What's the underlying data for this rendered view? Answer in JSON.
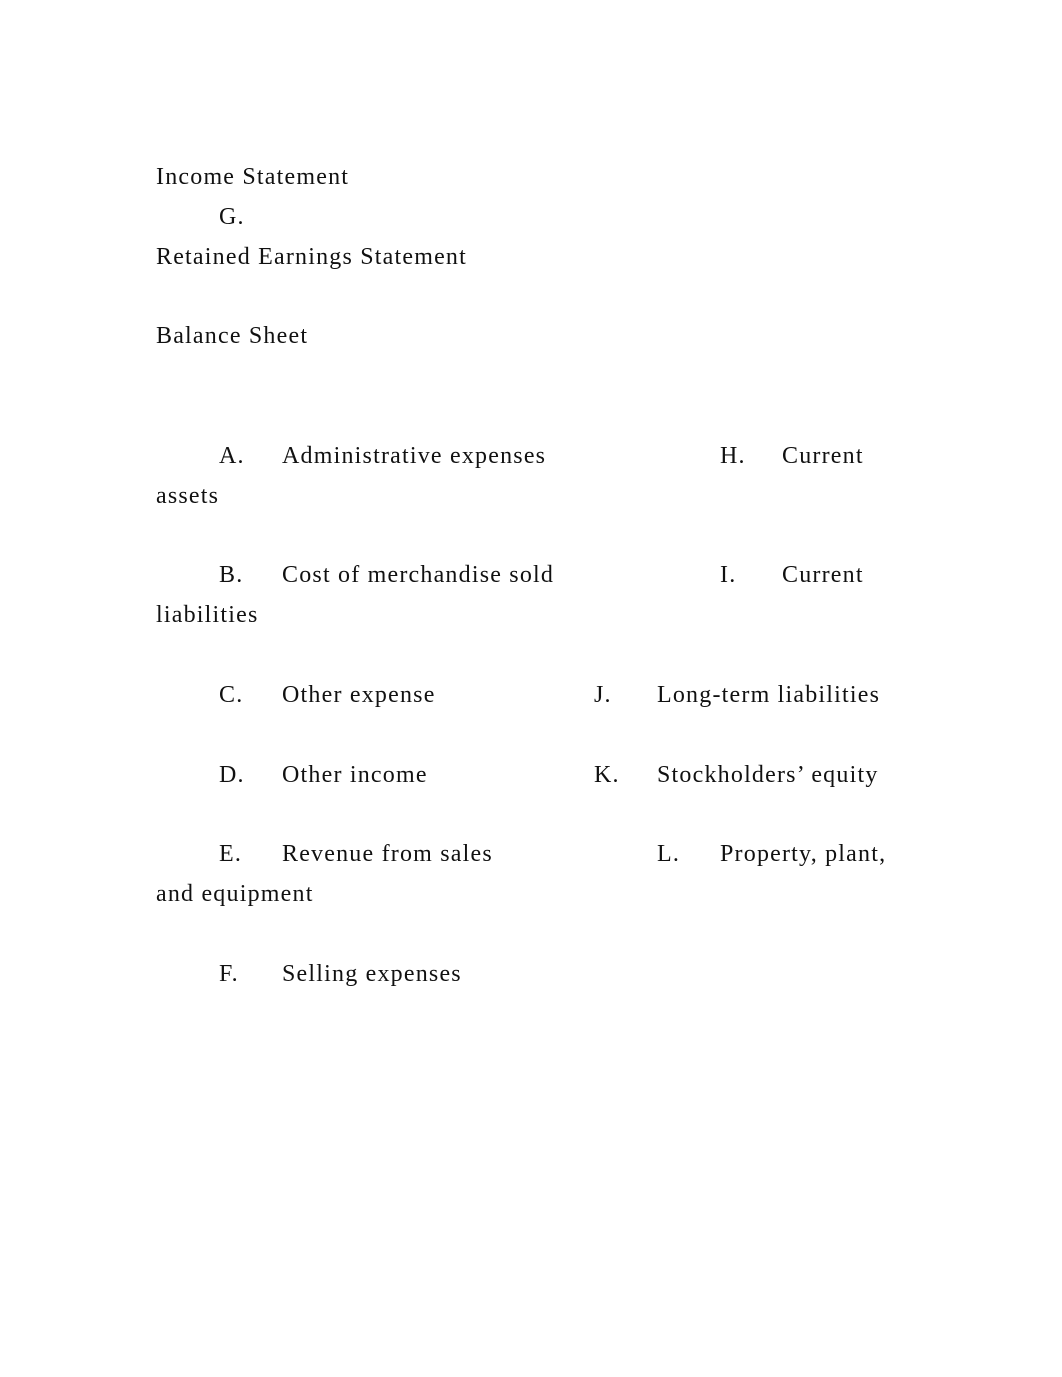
{
  "document": {
    "headings": {
      "income_statement": "Income Statement",
      "g_label": "G.",
      "retained_earnings": "Retained Earnings Statement",
      "balance_sheet": "Balance Sheet"
    },
    "items": {
      "A": {
        "letter": "A.",
        "text": "Administrative expenses"
      },
      "B": {
        "letter": "B.",
        "text": "Cost of merchandise sold"
      },
      "C": {
        "letter": "C.",
        "text": "Other expense"
      },
      "D": {
        "letter": "D.",
        "text": "Other income"
      },
      "E": {
        "letter": "E.",
        "text": "Revenue from sales"
      },
      "F": {
        "letter": "F.",
        "text": "Selling expenses"
      },
      "H": {
        "letter": "H.",
        "text": "Current",
        "continuation": "assets"
      },
      "I": {
        "letter": "I.",
        "text": "Current",
        "continuation": "liabilities"
      },
      "J": {
        "letter": "J.",
        "text": "Long-term liabilities"
      },
      "K": {
        "letter": "K.",
        "text": "Stockholders’ equity"
      },
      "L": {
        "letter": "L.",
        "text": "Property, plant,",
        "continuation": "and equipment"
      }
    }
  }
}
